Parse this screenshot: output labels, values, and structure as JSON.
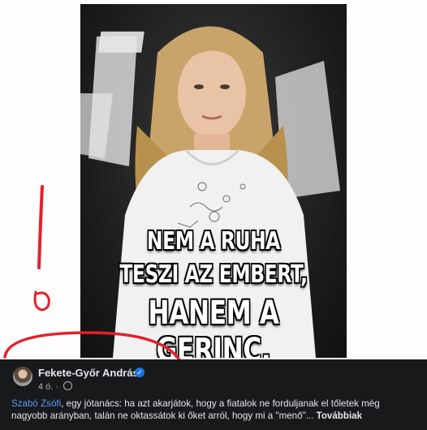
{
  "image": {
    "caption_line1": "NEM A RUHA",
    "caption_line2": "TESZI AZ EMBERT,",
    "caption_line3": "HANEM A GERINC."
  },
  "post": {
    "author": "Fekete-Győr András",
    "verified_icon": "check-icon",
    "time": "4 ó.",
    "separator": "·",
    "privacy_icon": "globe-icon",
    "mention": "Szabó Zsófi",
    "text": ", egy jótanács: ha azt akarjátok, hogy a fiatalok ne forduljanak el tőletek még nagyobb arányban, talán ne oktassátok ki őket arról, hogy mi a \"menő\"...",
    "see_more": "Továbbiak"
  },
  "colors": {
    "footer_bg": "#18191b",
    "mention": "#5b9cf6",
    "annotation": "#e3202b",
    "verified": "#1b74e4"
  }
}
